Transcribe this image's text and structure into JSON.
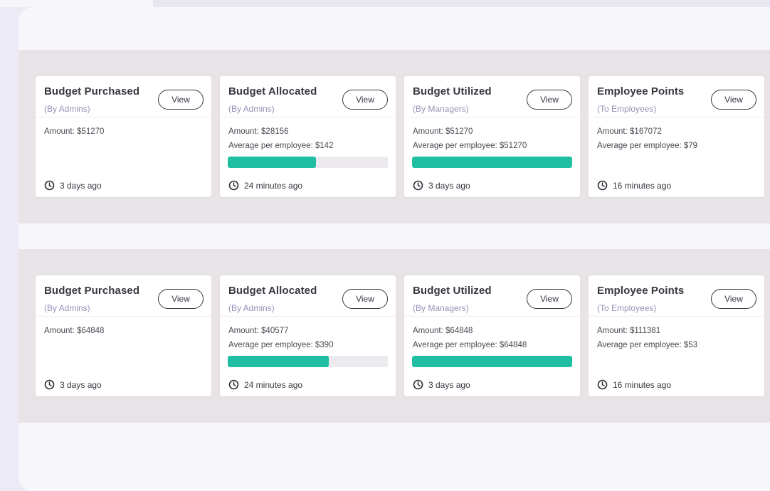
{
  "sections": [
    {
      "cards": [
        {
          "title": "Budget Purchased",
          "subtitle": "(By Admins)",
          "view_label": "View",
          "amount": "Amount: $51270",
          "average": "",
          "progress": null,
          "time": "3 days ago"
        },
        {
          "title": "Budget Allocated",
          "subtitle": "(By Admins)",
          "view_label": "View",
          "amount": "Amount: $28156",
          "average": "Average per employee: $142",
          "progress": 55,
          "time": "24 minutes ago"
        },
        {
          "title": "Budget Utilized",
          "subtitle": "(By Managers)",
          "view_label": "View",
          "amount": "Amount: $51270",
          "average": "Average per employee: $51270",
          "progress": 100,
          "time": "3 days ago"
        },
        {
          "title": "Employee Points",
          "subtitle": "(To Employees)",
          "view_label": "View",
          "amount": "Amount: $167072",
          "average": "Average per employee: $79",
          "progress": null,
          "time": "16 minutes ago"
        }
      ]
    },
    {
      "cards": [
        {
          "title": "Budget Purchased",
          "subtitle": "(By Admins)",
          "view_label": "View",
          "amount": "Amount: $64848",
          "average": "",
          "progress": null,
          "time": "3 days ago"
        },
        {
          "title": "Budget Allocated",
          "subtitle": "(By Admins)",
          "view_label": "View",
          "amount": "Amount: $40577",
          "average": "Average per employee: $390",
          "progress": 63,
          "time": "24 minutes ago"
        },
        {
          "title": "Budget Utilized",
          "subtitle": "(By Managers)",
          "view_label": "View",
          "amount": "Amount: $64848",
          "average": "Average per employee: $64848",
          "progress": 100,
          "time": "3 days ago"
        },
        {
          "title": "Employee Points",
          "subtitle": "(To Employees)",
          "view_label": "View",
          "amount": "Amount: $111381",
          "average": "Average per employee: $53",
          "progress": null,
          "time": "16 minutes ago"
        }
      ]
    }
  ],
  "icons": {
    "time": "clock-icon"
  },
  "colors": {
    "progress": "#20bfa3",
    "track": "#eceaef",
    "subtitle": "#9a8fb5"
  }
}
